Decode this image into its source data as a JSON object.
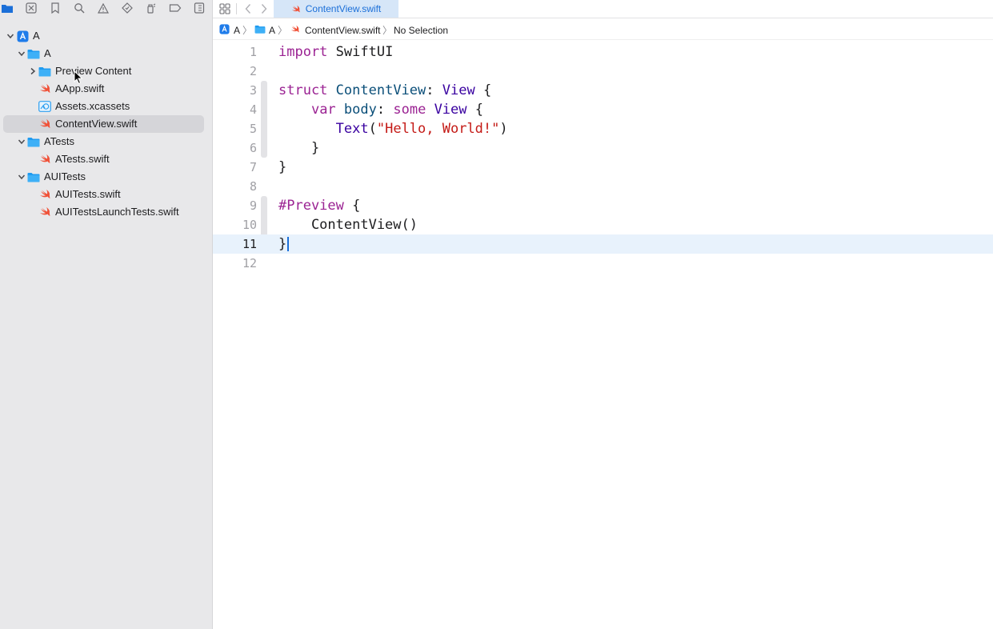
{
  "navigator": {
    "tree": [
      {
        "label": "A",
        "level": 0,
        "icon": "app-project-icon",
        "expanded": true
      },
      {
        "label": "A",
        "level": 1,
        "icon": "folder-icon",
        "expanded": true
      },
      {
        "label": "Preview Content",
        "level": 2,
        "icon": "folder-icon",
        "expanded": false
      },
      {
        "label": "AApp.swift",
        "level": 2,
        "icon": "swift-file-icon"
      },
      {
        "label": "Assets.xcassets",
        "level": 2,
        "icon": "asset-catalog-icon"
      },
      {
        "label": "ContentView.swift",
        "level": 2,
        "icon": "swift-file-icon",
        "selected": true
      },
      {
        "label": "ATests",
        "level": 1,
        "icon": "folder-icon",
        "expanded": true
      },
      {
        "label": "ATests.swift",
        "level": 2,
        "icon": "swift-file-icon"
      },
      {
        "label": "AUITests",
        "level": 1,
        "icon": "folder-icon",
        "expanded": true
      },
      {
        "label": "AUITests.swift",
        "level": 2,
        "icon": "swift-file-icon"
      },
      {
        "label": "AUITestsLaunchTests.swift",
        "level": 2,
        "icon": "swift-file-icon"
      }
    ]
  },
  "tabs": {
    "active_label": "ContentView.swift"
  },
  "jumpbar": {
    "project": "A",
    "group": "A",
    "file": "ContentView.swift",
    "symbol": "No Selection",
    "separator": "〉"
  },
  "editor": {
    "current_line": 11,
    "lines": [
      {
        "num": "1",
        "text": "import SwiftUI"
      },
      {
        "num": "2",
        "text": ""
      },
      {
        "num": "3",
        "text": "struct ContentView: View {"
      },
      {
        "num": "4",
        "text": "    var body: some View {"
      },
      {
        "num": "5",
        "text": "       Text(\"Hello, World!\")"
      },
      {
        "num": "6",
        "text": "    }"
      },
      {
        "num": "7",
        "text": "}"
      },
      {
        "num": "8",
        "text": ""
      },
      {
        "num": "9",
        "text": "#Preview {"
      },
      {
        "num": "10",
        "text": "    ContentView()"
      },
      {
        "num": "11",
        "text": "}"
      },
      {
        "num": "12",
        "text": ""
      }
    ]
  },
  "colors": {
    "accent": "#1b6fd8",
    "swift_orange": "#f05138",
    "folder_blue": "#1f9bf0",
    "keyword": "#9b2393",
    "string": "#c41a16",
    "type": "#3900a0"
  }
}
